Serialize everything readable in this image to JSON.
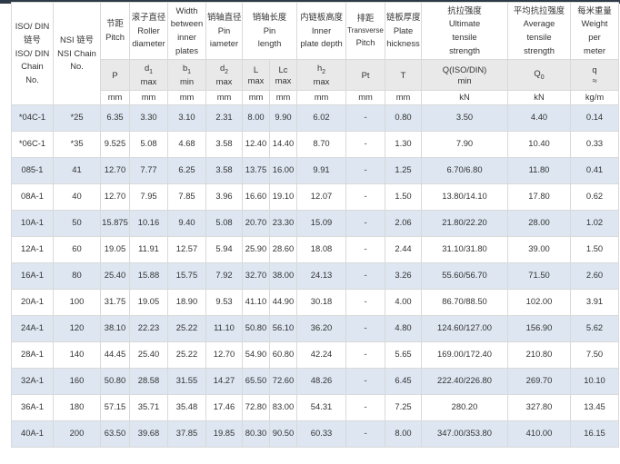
{
  "headers": [
    {
      "key": "iso",
      "lines": [
        "ISO/ DIN",
        "链号",
        "ISO/ DIN",
        "Chain",
        "No."
      ]
    },
    {
      "key": "ansi",
      "lines": [
        "",
        "NSI 链号",
        "NSI Chain",
        "No.",
        ""
      ]
    },
    {
      "key": "pitch",
      "lines": [
        "节距",
        "Pitch"
      ]
    },
    {
      "key": "roller",
      "lines": [
        "滚子直径",
        "Roller",
        "diameter"
      ]
    },
    {
      "key": "width",
      "lines": [
        "Width",
        "between",
        "inner",
        "plates"
      ]
    },
    {
      "key": "pin",
      "lines": [
        "销轴直径",
        "Pin",
        "iameter"
      ]
    },
    {
      "key": "length",
      "lines": [
        "销轴长度",
        "Pin",
        "length"
      ]
    },
    {
      "key": "depth",
      "lines": [
        "内链板高度",
        "Inner",
        "plate depth"
      ]
    },
    {
      "key": "transverse",
      "lines": [
        "排距",
        "Transverse",
        "Pitch"
      ]
    },
    {
      "key": "thickness",
      "lines": [
        "链板厚度",
        "Plate",
        "hickness"
      ]
    },
    {
      "key": "tensile",
      "lines": [
        "抗拉强度",
        "Ultimate",
        "tensile",
        "strength"
      ]
    },
    {
      "key": "avg",
      "lines": [
        "平均抗拉强度",
        "Average",
        "tensile",
        "strength"
      ]
    },
    {
      "key": "weight",
      "lines": [
        "每米重量",
        "Weight",
        "per",
        "meter"
      ]
    }
  ],
  "symbols": [
    {
      "main": "P",
      "sub": ""
    },
    {
      "main": "d",
      "idx": "1",
      "sub": "max"
    },
    {
      "main": "b",
      "idx": "1",
      "sub": "min"
    },
    {
      "main": "d",
      "idx": "2",
      "sub": "max"
    },
    {
      "main": "L",
      "sub": "max"
    },
    {
      "main": "Lc",
      "sub": "max"
    },
    {
      "main": "h",
      "idx": "2",
      "sub": "max"
    },
    {
      "main": "Pt",
      "sub": ""
    },
    {
      "main": "T",
      "sub": ""
    },
    {
      "main": "Q(ISO/DIN)",
      "sub": "min"
    },
    {
      "main": "Q",
      "idx": "0",
      "sub": ""
    },
    {
      "main": "q",
      "sub": "≈"
    }
  ],
  "units": [
    "mm",
    "mm",
    "mm",
    "mm",
    "mm",
    "mm",
    "mm",
    "mm",
    "mm",
    "kN",
    "kN",
    "kg/m"
  ],
  "rows": [
    [
      "*04C-1",
      "*25",
      "6.35",
      "3.30",
      "3.10",
      "2.31",
      "8.00",
      "9.90",
      "6.02",
      "-",
      "0.80",
      "3.50",
      "4.40",
      "0.14"
    ],
    [
      "*06C-1",
      "*35",
      "9.525",
      "5.08",
      "4.68",
      "3.58",
      "12.40",
      "14.40",
      "8.70",
      "-",
      "1.30",
      "7.90",
      "10.40",
      "0.33"
    ],
    [
      "085-1",
      "41",
      "12.70",
      "7.77",
      "6.25",
      "3.58",
      "13.75",
      "16.00",
      "9.91",
      "-",
      "1.25",
      "6.70/6.80",
      "11.80",
      "0.41"
    ],
    [
      "08A-1",
      "40",
      "12.70",
      "7.95",
      "7.85",
      "3.96",
      "16.60",
      "19.10",
      "12.07",
      "-",
      "1.50",
      "13.80/14.10",
      "17.80",
      "0.62"
    ],
    [
      "10A-1",
      "50",
      "15.875",
      "10.16",
      "9.40",
      "5.08",
      "20.70",
      "23.30",
      "15.09",
      "-",
      "2.06",
      "21.80/22.20",
      "28.00",
      "1.02"
    ],
    [
      "12A-1",
      "60",
      "19.05",
      "11.91",
      "12.57",
      "5.94",
      "25.90",
      "28.60",
      "18.08",
      "-",
      "2.44",
      "31.10/31.80",
      "39.00",
      "1.50"
    ],
    [
      "16A-1",
      "80",
      "25.40",
      "15.88",
      "15.75",
      "7.92",
      "32.70",
      "38.00",
      "24.13",
      "-",
      "3.26",
      "55.60/56.70",
      "71.50",
      "2.60"
    ],
    [
      "20A-1",
      "100",
      "31.75",
      "19.05",
      "18.90",
      "9.53",
      "41.10",
      "44.90",
      "30.18",
      "-",
      "4.00",
      "86.70/88.50",
      "102.00",
      "3.91"
    ],
    [
      "24A-1",
      "120",
      "38.10",
      "22.23",
      "25.22",
      "11.10",
      "50.80",
      "56.10",
      "36.20",
      "-",
      "4.80",
      "124.60/127.00",
      "156.90",
      "5.62"
    ],
    [
      "28A-1",
      "140",
      "44.45",
      "25.40",
      "25.22",
      "12.70",
      "54.90",
      "60.80",
      "42.24",
      "-",
      "5.65",
      "169.00/172.40",
      "210.80",
      "7.50"
    ],
    [
      "32A-1",
      "160",
      "50.80",
      "28.58",
      "31.55",
      "14.27",
      "65.50",
      "72.60",
      "48.26",
      "-",
      "6.45",
      "222.40/226.80",
      "269.70",
      "10.10"
    ],
    [
      "36A-1",
      "180",
      "57.15",
      "35.71",
      "35.48",
      "17.46",
      "72.80",
      "83.00",
      "54.31",
      "-",
      "7.25",
      "280.20",
      "327.80",
      "13.45"
    ],
    [
      "40A-1",
      "200",
      "63.50",
      "39.68",
      "37.85",
      "19.85",
      "80.30",
      "90.50",
      "60.33",
      "-",
      "8.00",
      "347.00/353.80",
      "410.00",
      "16.15"
    ]
  ]
}
